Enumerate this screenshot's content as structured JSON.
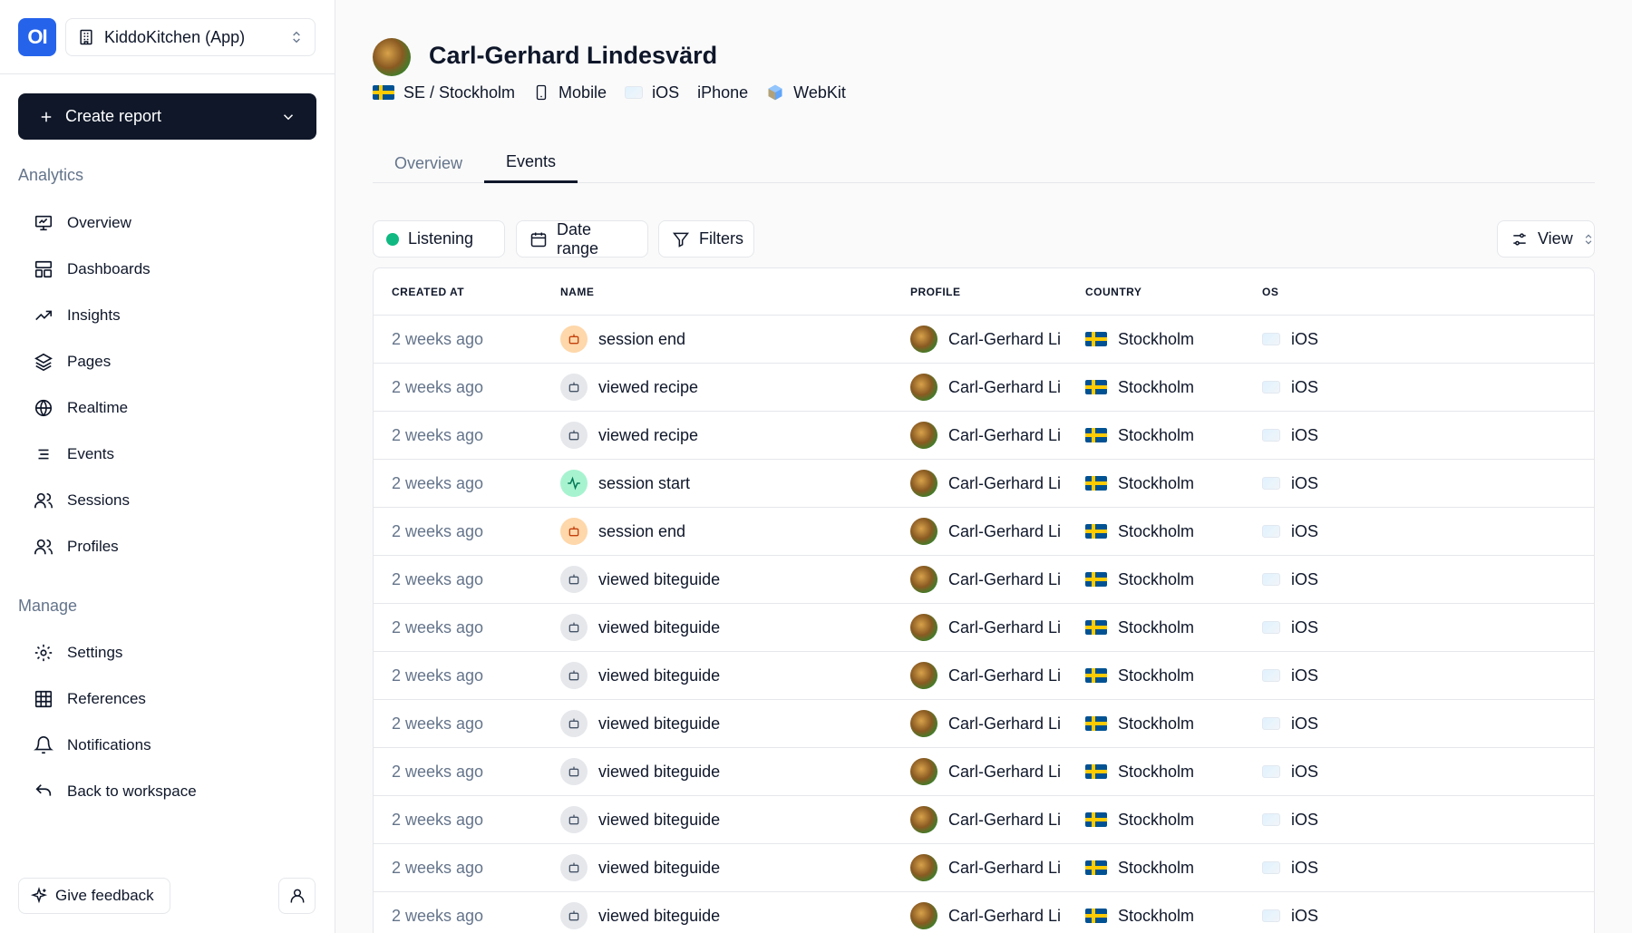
{
  "sidebar": {
    "logo_text": "OI",
    "project_name": "KiddoKitchen (App)",
    "create_report_label": "Create report",
    "analytics_label": "Analytics",
    "analytics_items": [
      {
        "label": "Overview",
        "icon": "presentation-icon"
      },
      {
        "label": "Dashboards",
        "icon": "layout-icon"
      },
      {
        "label": "Insights",
        "icon": "trending-icon"
      },
      {
        "label": "Pages",
        "icon": "layers-icon"
      },
      {
        "label": "Realtime",
        "icon": "globe-icon"
      },
      {
        "label": "Events",
        "icon": "list-icon"
      },
      {
        "label": "Sessions",
        "icon": "users-icon"
      },
      {
        "label": "Profiles",
        "icon": "users-icon"
      }
    ],
    "manage_label": "Manage",
    "manage_items": [
      {
        "label": "Settings",
        "icon": "gear-icon"
      },
      {
        "label": "References",
        "icon": "grid-icon"
      },
      {
        "label": "Notifications",
        "icon": "bell-icon"
      },
      {
        "label": "Back to workspace",
        "icon": "undo-icon"
      }
    ],
    "feedback_label": "Give feedback"
  },
  "profile": {
    "name": "Carl-Gerhard Lindesvärd",
    "location": "SE / Stockholm",
    "device": "Mobile",
    "os": "iOS",
    "model": "iPhone",
    "browser": "WebKit"
  },
  "tabs": [
    {
      "label": "Overview",
      "active": false
    },
    {
      "label": "Events",
      "active": true
    }
  ],
  "toolbar": {
    "listening_label": "Listening",
    "date_range_label": "Date range",
    "filters_label": "Filters",
    "view_label": "View"
  },
  "table": {
    "headers": [
      "CREATED AT",
      "NAME",
      "PROFILE",
      "COUNTRY",
      "OS"
    ],
    "rows": [
      {
        "created": "2 weeks ago",
        "name": "session end",
        "icon": "orange",
        "profile": "Carl-Gerhard Li",
        "country": "Stockholm",
        "os": "iOS"
      },
      {
        "created": "2 weeks ago",
        "name": "viewed recipe",
        "icon": "gray",
        "profile": "Carl-Gerhard Li",
        "country": "Stockholm",
        "os": "iOS"
      },
      {
        "created": "2 weeks ago",
        "name": "viewed recipe",
        "icon": "gray",
        "profile": "Carl-Gerhard Li",
        "country": "Stockholm",
        "os": "iOS"
      },
      {
        "created": "2 weeks ago",
        "name": "session start",
        "icon": "teal",
        "profile": "Carl-Gerhard Li",
        "country": "Stockholm",
        "os": "iOS"
      },
      {
        "created": "2 weeks ago",
        "name": "session end",
        "icon": "orange",
        "profile": "Carl-Gerhard Li",
        "country": "Stockholm",
        "os": "iOS"
      },
      {
        "created": "2 weeks ago",
        "name": "viewed biteguide",
        "icon": "gray",
        "profile": "Carl-Gerhard Li",
        "country": "Stockholm",
        "os": "iOS"
      },
      {
        "created": "2 weeks ago",
        "name": "viewed biteguide",
        "icon": "gray",
        "profile": "Carl-Gerhard Li",
        "country": "Stockholm",
        "os": "iOS"
      },
      {
        "created": "2 weeks ago",
        "name": "viewed biteguide",
        "icon": "gray",
        "profile": "Carl-Gerhard Li",
        "country": "Stockholm",
        "os": "iOS"
      },
      {
        "created": "2 weeks ago",
        "name": "viewed biteguide",
        "icon": "gray",
        "profile": "Carl-Gerhard Li",
        "country": "Stockholm",
        "os": "iOS"
      },
      {
        "created": "2 weeks ago",
        "name": "viewed biteguide",
        "icon": "gray",
        "profile": "Carl-Gerhard Li",
        "country": "Stockholm",
        "os": "iOS"
      },
      {
        "created": "2 weeks ago",
        "name": "viewed biteguide",
        "icon": "gray",
        "profile": "Carl-Gerhard Li",
        "country": "Stockholm",
        "os": "iOS"
      },
      {
        "created": "2 weeks ago",
        "name": "viewed biteguide",
        "icon": "gray",
        "profile": "Carl-Gerhard Li",
        "country": "Stockholm",
        "os": "iOS"
      },
      {
        "created": "2 weeks ago",
        "name": "viewed biteguide",
        "icon": "gray",
        "profile": "Carl-Gerhard Li",
        "country": "Stockholm",
        "os": "iOS"
      }
    ]
  },
  "colors": {
    "primary_dark": "#0f1729",
    "brand_blue": "#2563eb",
    "listening_green": "#10b981",
    "muted_text": "#64748b"
  }
}
